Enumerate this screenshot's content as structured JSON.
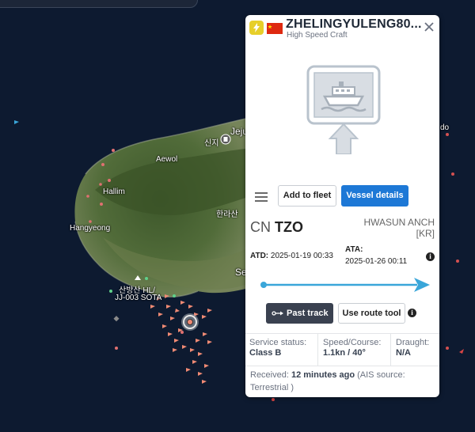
{
  "map": {
    "labels": {
      "jeju": "Jeju",
      "sinji": "신지",
      "aewol": "Aewol",
      "hallim": "Hallim",
      "hallasan": "한라산",
      "hangyeong": "Hangyeong",
      "heliport_line1": "산방산 HL/",
      "heliport_line2": "JJ-003 SOTA",
      "se": "Se",
      "do": "do"
    }
  },
  "vessel": {
    "name": "ZHELINGYULENG80...",
    "type": "High Speed Craft",
    "flag_country": "CN",
    "icons": {
      "category": "lightning-icon",
      "flag": "china-flag",
      "close": "close-icon",
      "photo": "vessel-placeholder-icon",
      "menu": "hamburger-icon",
      "info": "info-icon",
      "track": "track-icon"
    }
  },
  "actions": {
    "add_to_fleet": "Add to fleet",
    "vessel_details": "Vessel details",
    "past_track": "Past track",
    "use_route_tool": "Use route tool"
  },
  "voyage": {
    "origin_country": "CN",
    "origin_port": "TZO",
    "destination": "HWASUN ANCH",
    "destination_country": "[KR]",
    "atd_label": "ATD:",
    "atd_value": "2025-01-19 00:33",
    "ata_label": "ATA:",
    "ata_value": "2025-01-26 00:11"
  },
  "status": {
    "service_label": "Service status:",
    "service_value": "Class B",
    "speed_label": "Speed/Course:",
    "speed_value": "1.1kn / 40°",
    "draught_label": "Draught:",
    "draught_value": "N/A"
  },
  "received": {
    "label": "Received:",
    "age": "12 minutes ago",
    "source_prefix": "(AIS source:",
    "source": "Terrestrial )"
  },
  "colors": {
    "accent_blue": "#1d78d6",
    "dark_button": "#3a4150",
    "flag_red": "#de2910",
    "category_yellow": "#e7cf2a",
    "route_line": "#3aa6d9",
    "map_water": "#0d1a30"
  }
}
